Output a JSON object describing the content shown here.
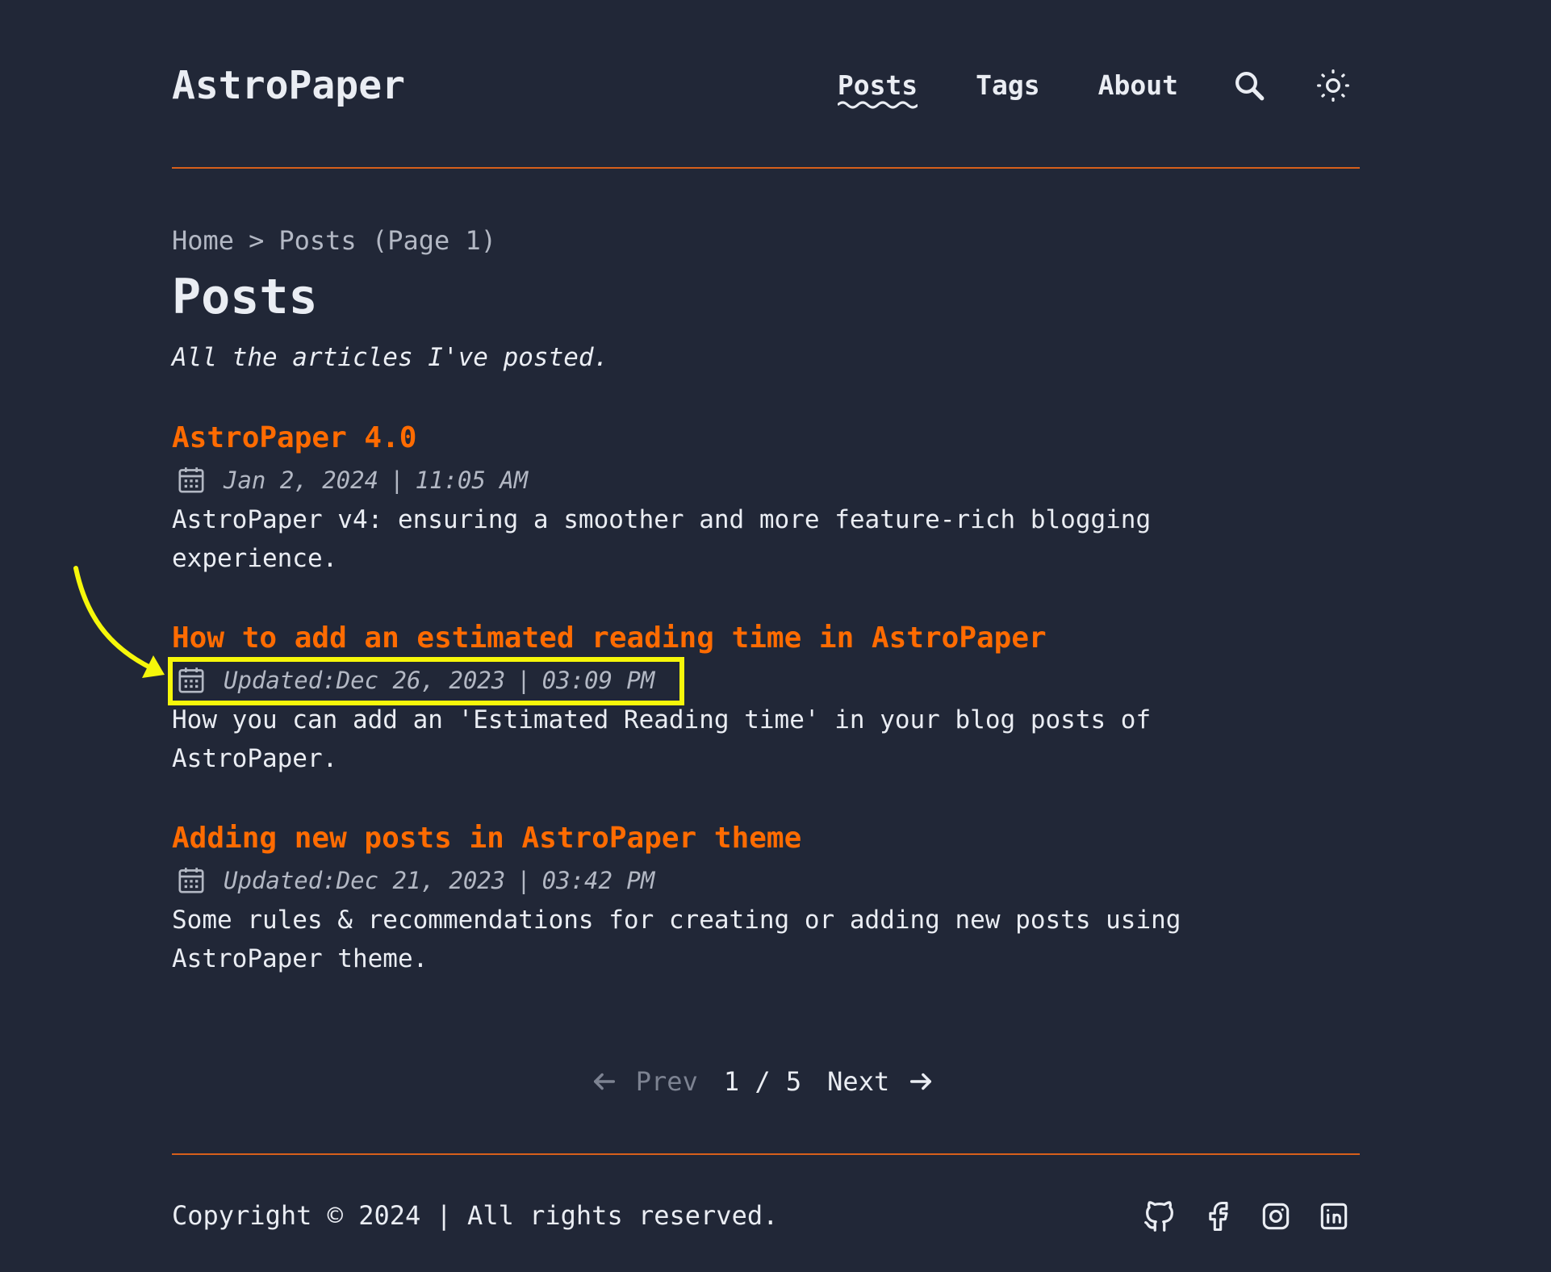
{
  "site": {
    "logo": "AstroPaper"
  },
  "nav": {
    "items": [
      {
        "label": "Posts",
        "active": true
      },
      {
        "label": "Tags",
        "active": false
      },
      {
        "label": "About",
        "active": false
      }
    ],
    "search_icon": "search-icon",
    "theme_icon": "sun-icon"
  },
  "breadcrumb": {
    "home": "Home",
    "separator": ">",
    "current": "Posts (Page 1)"
  },
  "page": {
    "title": "Posts",
    "description": "All the articles I've posted."
  },
  "posts": [
    {
      "title": "AstroPaper 4.0",
      "date_prefix": "",
      "date": "Jan 2, 2024",
      "time": "11:05 AM",
      "description": "AstroPaper v4: ensuring a smoother and more feature-rich blogging experience."
    },
    {
      "title": "How to add an estimated reading time in AstroPaper",
      "date_prefix": "Updated: ",
      "date": "Dec 26, 2023",
      "time": "03:09 PM",
      "description": "How you can add an 'Estimated Reading time' in your blog posts of AstroPaper."
    },
    {
      "title": "Adding new posts in AstroPaper theme",
      "date_prefix": "Updated: ",
      "date": "Dec 21, 2023",
      "time": "03:42 PM",
      "description": "Some rules & recommendations for creating or adding new posts using AstroPaper theme."
    }
  ],
  "pagination": {
    "prev": "Prev",
    "current": "1 / 5",
    "next": "Next"
  },
  "footer": {
    "copyright": "Copyright © 2024 | All rights reserved.",
    "socials": [
      "github-icon",
      "facebook-icon",
      "instagram-icon",
      "linkedin-icon"
    ]
  },
  "colors": {
    "background": "#212737",
    "text": "#eaedf3",
    "accent": "#ff6b01",
    "divider": "#d65f1b",
    "muted": "#b3b8c4",
    "annotation": "#f6f70a"
  }
}
